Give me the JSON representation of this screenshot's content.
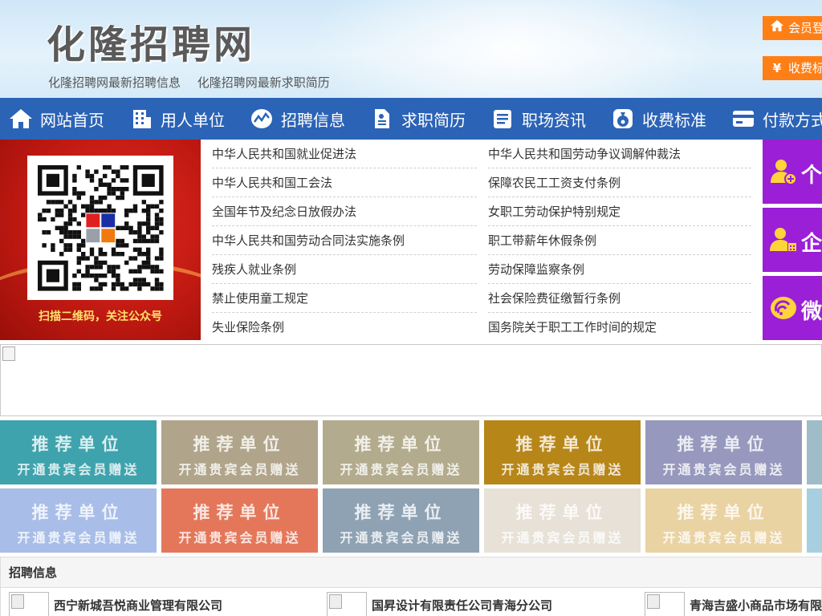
{
  "header": {
    "site_title": "化隆招聘网",
    "sub_links": [
      "化隆招聘网最新招聘信息",
      "化隆招聘网最新求职简历"
    ],
    "buttons": [
      {
        "icon": "home-icon",
        "label": "会员登录"
      },
      {
        "icon": "yen-icon",
        "label": "收费标准"
      }
    ]
  },
  "nav": {
    "items": [
      {
        "icon": "home-icon",
        "label": "网站首页"
      },
      {
        "icon": "building-icon",
        "label": "用人单位"
      },
      {
        "icon": "chart-icon",
        "label": "招聘信息"
      },
      {
        "icon": "resume-icon",
        "label": "求职简历"
      },
      {
        "icon": "news-icon",
        "label": "职场资讯"
      },
      {
        "icon": "money-bag-icon",
        "label": "收费标准"
      },
      {
        "icon": "card-icon",
        "label": "付款方式"
      }
    ]
  },
  "qr": {
    "caption": "扫描二维码，关注公众号"
  },
  "laws": {
    "left": [
      "中华人民共和国就业促进法",
      "中华人民共和国工会法",
      "全国年节及纪念日放假办法",
      "中华人民共和国劳动合同法实施条例",
      "残疾人就业条例",
      "禁止使用童工规定",
      "失业保险条例"
    ],
    "right": [
      "中华人民共和国劳动争议调解仲裁法",
      "保障农民工工资支付条例",
      "女职工劳动保护特别规定",
      "职工带薪年休假条例",
      "劳动保障监察条例",
      "社会保险费征缴暂行条例",
      "国务院关于职工工作时间的规定"
    ]
  },
  "side_tiles": [
    {
      "icon": "user-add-icon",
      "label": "个人注册"
    },
    {
      "icon": "company-user-icon",
      "label": "企业注册"
    },
    {
      "icon": "wechat-icon",
      "label": "微信登录"
    }
  ],
  "recommend": {
    "title": "推荐单位",
    "subtitle": "开通贵宾会员赠送",
    "colors": [
      "#3fa3ad",
      "#b0a58a",
      "#b3ab8d",
      "#b78619",
      "#9699bd",
      "#9fbcc9",
      "#a8bde8",
      "#e4775a",
      "#8ea2b4",
      "#e7e1d7",
      "#ead3a3",
      "#a8cfe0"
    ]
  },
  "jobs": {
    "heading": "招聘信息",
    "items": [
      "西宁新城吾悦商业管理有限公司",
      "国昇设计有限责任公司青海分公司",
      "青海吉盛小商品市场有限公司"
    ]
  }
}
